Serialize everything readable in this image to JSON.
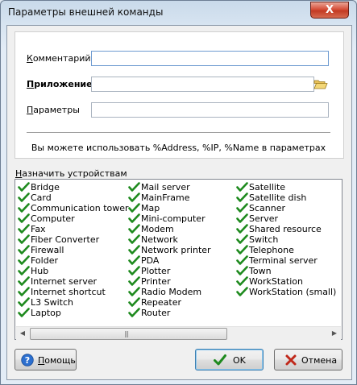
{
  "window": {
    "title": "Параметры внешней команды",
    "close_label": "X"
  },
  "form": {
    "comment_label": "Комментарий",
    "comment_value": "",
    "app_label": "Приложение",
    "app_value": "",
    "params_label": "Параметры",
    "params_value": "",
    "hint": "Вы можете использовать %Address, %IP, %Name в параметрах"
  },
  "devices": {
    "label": "Назначить устройствам",
    "columns": [
      [
        "Bridge",
        "Card",
        "Communication tower",
        "Computer",
        "Fax",
        "Fiber Converter",
        "Firewall",
        "Folder",
        "Hub",
        "Internet server",
        "Internet shortcut",
        "L3 Switch",
        "Laptop"
      ],
      [
        "Mail server",
        "MainFrame",
        "Map",
        "Mini-computer",
        "Modem",
        "Network",
        "Network printer",
        "PDA",
        "Plotter",
        "Printer",
        "Radio Modem",
        "Repeater",
        "Router"
      ],
      [
        "Satellite",
        "Satellite dish",
        "Scanner",
        "Server",
        "Shared resource",
        "Switch",
        "Telephone",
        "Terminal server",
        "Town",
        "WorkStation",
        "WorkStation (small)"
      ]
    ],
    "all_checked": true
  },
  "buttons": {
    "help": "Помощь",
    "ok": "OK",
    "cancel": "Отмена"
  },
  "colors": {
    "check": "#1e8a1e",
    "title_bg": "#c9daea",
    "close_bg": "#c94a32"
  }
}
